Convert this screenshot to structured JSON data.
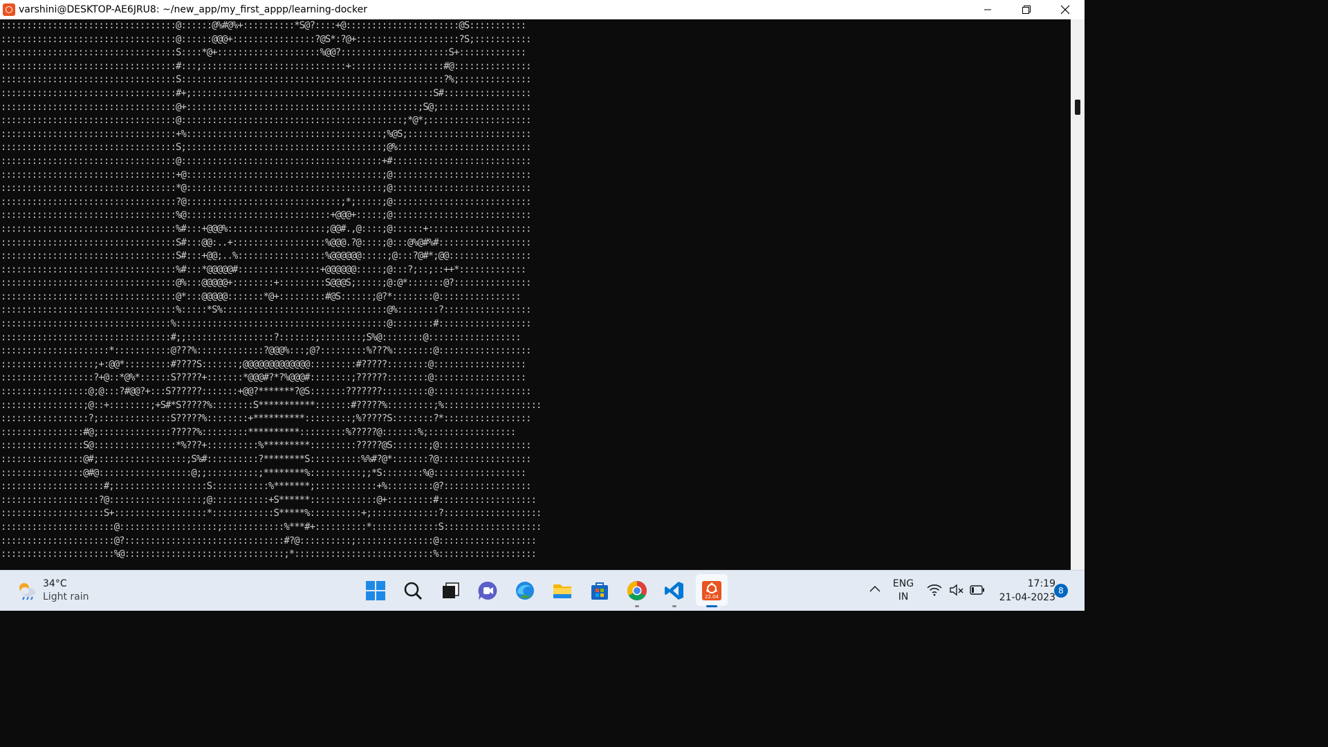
{
  "window": {
    "title": "varshini@DESKTOP-AE6JRU8: ~/new_app/my_first_appp/learning-docker"
  },
  "terminal": {
    "lines": [
      "::::::::::::::::::::::::::::::::::@::::::@%#@%+::::::::::*S@?::::+@::::::::::::::::::::::@S:::::::::::",
      "::::::::::::::::::::::::::::::::::@::::::@@@+::::::::::::::::?@S*:?@+::::::::::::::::::::?S;:::::::::::",
      "::::::::::::::::::::::::::::::::::S::::*@+::::::::::::::::::::%@@?:::::::::::::::::::::S+:::::::::::::",
      "::::::::::::::::::::::::::::::::::#:::;::::::::::::::::::::::::::::+::::::::::::::::::#@:::::::::::::::",
      "::::::::::::::::::::::::::::::::::S:::::::::::::::::::::::::::::::::::::::::::::::::::?%;::::::::::::::",
      "::::::::::::::::::::::::::::::::::#+;:::::::::::::::::::::::::::::::::::::::::::::::S#:::::::::::::::::",
      "::::::::::::::::::::::::::::::::::@+:::::::::::::::::::::::::::::::::::::::::::::;S@;::::::::::::::::::",
      "::::::::::::::::::::::::::::::::::@:::::::::::::::::::::::::::::::::::::::::::;*@*;::::::::::::::::::::",
      "::::::::::::::::::::::::::::::::::+%::::::::::::::::::::::::::::::::::::::;%@S;::::::::::::::::::::::::",
      "::::::::::::::::::::::::::::::::::S;::::::::::::::::::::::::::::::::::::::;@%::::::::::::::::::::::::::",
      "::::::::::::::::::::::::::::::::::@:::::::::::::::::::::::::::::::::::::::+#:::::::::::::::::::::::::::",
      "::::::::::::::::::::::::::::::::::+@::::::::::::::::::::::::::::::::::::::;@:::::::::::::::::::::::::::",
      "::::::::::::::::::::::::::::::::::*@::::::::::::::::::::::::::::::::::::::;@:::::::::::::::::::::::::::",
      "::::::::::::::::::::::::::::::::::?@::::::::::::::::::::::::::::::;*;:::::;@:::::::::::::::::::::::::::",
      "::::::::::::::::::::::::::::::::::%@::::::::::::::::::::::::::::+@@@+:::::;@:::::::::::::::::::::::::::",
      "::::::::::::::::::::::::::::::::::%#:::+@@@%:::::::::::::::::::;@@#.,@::::;@::::::+::::::::::::::::::::",
      "::::::::::::::::::::::::::::::::::S#:::@@:..+::::::::::::::::::%@@@.?@::::;@:::@%@#%#::::::::::::::::::",
      "::::::::::::::::::::::::::::::::::S#:::+@@;..%:::::::::::::::::%@@@@@@:::::;@:::?@#*;@@::::::::::::::::",
      "::::::::::::::::::::::::::::::::::%#:::*@@@@@#::::::::::::::::+@@@@@@:::::;@:::?;::;::++*:::::::::::::",
      "::::::::::::::::::::::::::::::::::@%:::@@@@@+::::::::+:::::::::S@@@S;:::::;@:@*:::::::@?:::::::::::::::",
      "::::::::::::::::::::::::::::::::::@*:::@@@@@:::::::*@+:::::::::#@S::::::;@?*::::::::@::::::::::::::::",
      "::::::::::::::::::::::::::::::::::%:::::*S%::::::::::::::::::::::::::::::::@%::::::::?:::::::::::::::::",
      ":::::::::::::::::::::::::::::::::%:::::::::::::::::::::::::::::::::::::::::@::::::::#::::::::::::::::::",
      ":::::::::::::::::::::::::::::::::#;;:::::::::::::::::?:::::::;::::::::;S%@::::::::@::::::::::::::::::",
      ":::::::::::::::::::::*:::::::::::@???%:::::::::::::?@@@%:::;@?:::::::::%???%::::::::@::::::::::::::::::",
      "::::::::::::::::::;+:@@*:::::::::#????S:::::::;@@@@@@@@@@@@@:::::::::#?????::::::::@::::::::::::::::::",
      "::::::::::::::::::?+@::*@%*::::::S?????+:::::::*@@@#?*?%@@@#::::::::;??????::::::::@::::::::::::::::::",
      ":::::::::::::::::@;@:::?#@@?+:::S??????:::::::+@@?*******?@S:::::::???????:::::::::@:::::::::::::::::::",
      "::::::::::::::::;@::+::::::::;+S#*S?????%::::::::S***********:::::::#?????%:::::::::;%:::::::::::::::::::",
      ":::::::::::::::::?;::::::::::::::S?????%::::::::+**********:::::::::;%?????S::::::::?*:::::::::::::::::",
      "::::::::::::::::#@;::::::::::::::?????%:::::::::**********:::::::::%?????@:::::::%;:::::::::::::::::",
      "::::::::::::::::S@::::::::::::::::*%???+::::::::::%*********:::::::::?????@S:::::::;@::::::::::::::::::",
      "::::::::::::::::@#;:::::::::::::::::;S%#::::::::::?********S::::::::::%%#?@*:::::::?@::::::::::::::::::",
      "::::::::::::::::@#@::::::::::::::::::@;;::::::::::;********%::::::::::;;*S::::::::%@::::::::::::::::::",
      "::::::::::::::::::::#;::::::::::::::::::S:::::::::::%*******;::::::::::::+%:::::::::@?:::::::::::::::::",
      ":::::::::::::::::::?@::::::::::::::::::;@:::::::::::+S******:::::::::::::@+:::::::::#:::::::::::::::::::",
      "::::::::::::::::::::S+::::::::::::::::::*::::::::::::S*****%::::::::::+;:::::::::::::?:::::::::::::::::::",
      "::::::::::::::::::::::@:::::::::::::::::::;::::::::::::%***#+::::::::::*:::::::::::::S:::::::::::::::::::",
      "::::::::::::::::::::::@?:::::::::::::::::::::::::::::::#?@::::::::::;:::::::::::::::@:::::::::::::::::::",
      "::::::::::::::::::::::%@:::::::::::::::::::::::::::::::;*:::::::::::::::::::::::::::%:::::::::::::::::::"
    ]
  },
  "taskbar": {
    "weather": {
      "temp": "34°C",
      "condition": "Light rain"
    },
    "apps": [
      {
        "name": "start-button",
        "icon": "windows-icon"
      },
      {
        "name": "search-button",
        "icon": "search-icon"
      },
      {
        "name": "task-view-button",
        "icon": "task-view-icon"
      },
      {
        "name": "teams-chat-button",
        "icon": "teams-chat-icon"
      },
      {
        "name": "edge-button",
        "icon": "edge-icon"
      },
      {
        "name": "file-explorer-button",
        "icon": "folder-icon"
      },
      {
        "name": "microsoft-store-button",
        "icon": "store-icon"
      },
      {
        "name": "chrome-button",
        "icon": "chrome-icon"
      },
      {
        "name": "vscode-button",
        "icon": "vscode-icon"
      },
      {
        "name": "ubuntu-button",
        "icon": "ubuntu-icon",
        "badge": "22.04"
      }
    ],
    "tray": {
      "language_line1": "ENG",
      "language_line2": "IN",
      "time": "17:19",
      "date": "21-04-2023",
      "notifications": "8"
    }
  }
}
